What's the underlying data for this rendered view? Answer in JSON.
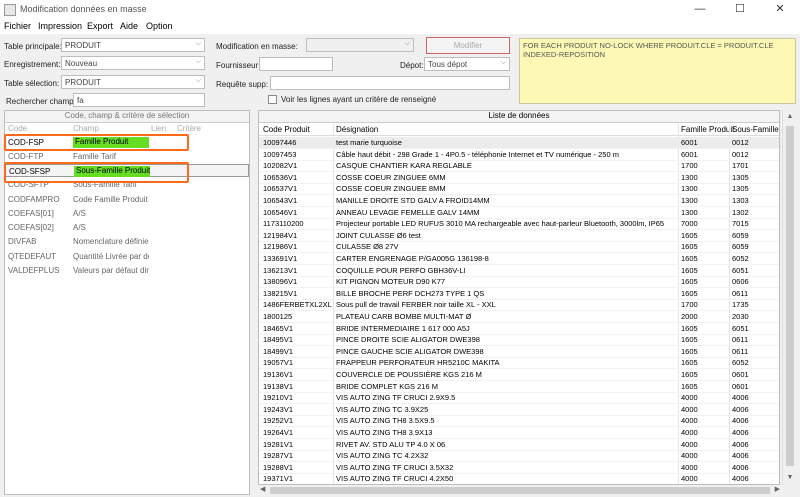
{
  "window": {
    "title": "Modification données en masse",
    "minimize": "—",
    "maximize": "☐",
    "close": "✕"
  },
  "menu": [
    "Fichier",
    "Impression",
    "Export",
    "Aide",
    "Option"
  ],
  "filters": {
    "table_principale_label": "Table principale:",
    "table_principale_value": "PRODUIT",
    "enregistrement_label": "Enregistrement:",
    "enregistrement_value": "Nouveau",
    "table_selection_label": "Table sélection:",
    "table_selection_value": "PRODUIT",
    "rechercher_label": "Rechercher champ:",
    "rechercher_value": "fa",
    "modif_masse_label": "Modification en masse:",
    "modif_masse_value": "",
    "modifier_button": "Modifier",
    "fournisseur_label": "Fournisseur:",
    "fournisseur_value": "",
    "depot_label": "Dépot:",
    "depot_value": "Tous dépot",
    "requete_label": "Requête supp:",
    "requete_value": "",
    "voir_lignes_label": "Voir les lignes ayant un critère de renseigné",
    "query_text": "FOR EACH PRODUIT NO-LOCK WHERE PRODUIT.CLE = PRODUIT.CLE INDEXED-REPOSITION"
  },
  "left_panel": {
    "header": "Code, champ & critère de sélection",
    "columns": [
      "Code",
      "Champ",
      "Lien",
      "Critère"
    ],
    "rows": [
      {
        "code": "COD-FSP",
        "champ": "Famille Produit",
        "green": true,
        "selected": true
      },
      {
        "code": "COD-FTP",
        "champ": "Famille Tarif"
      },
      {
        "code": "COD-SFSP",
        "champ": "Sous-Famille Produit",
        "green": true,
        "selected": true
      },
      {
        "code": "COD-SFTP",
        "champ": "Sous-Famille Tarif"
      },
      {
        "code": "CODFAMPRO",
        "champ": "Code Famille Produit"
      },
      {
        "code": "COEFAS[01]",
        "champ": "A/S"
      },
      {
        "code": "COEFAS[02]",
        "champ": "A/S"
      },
      {
        "code": "DIVFAB",
        "champ": "Nomenclature définie pour"
      },
      {
        "code": "QTEDEFAUT",
        "champ": "Quantité Livrée par défaut"
      },
      {
        "code": "VALDEFPLUS",
        "champ": "Valeurs par défaut dimensio"
      }
    ]
  },
  "right_panel": {
    "header": "Liste de données",
    "columns": [
      "Code Produit",
      "Désignation",
      "Famille Produit",
      "Sous-Famille Produit"
    ],
    "rows": [
      [
        "10097446",
        "test marie turquoise",
        "6001",
        "0012"
      ],
      [
        "10097453",
        "Câble haut débit - 298 Grade 1 - 4P0.5 - téléphonie Internet et TV numérique - 250 m",
        "6001",
        "0012"
      ],
      [
        "102082V1",
        "CASQUE CHANTIER KARA REGLABLE",
        "1700",
        "1701"
      ],
      [
        "106536V1",
        "COSSE COEUR ZINGUEE 6MM",
        "1300",
        "1305"
      ],
      [
        "106537V1",
        "COSSE COEUR ZINGUEE 8MM",
        "1300",
        "1305"
      ],
      [
        "106543V1",
        "MANILLE DROITE STD GALV A FROID14MM",
        "1300",
        "1303"
      ],
      [
        "106546V1",
        "ANNEAU LEVAGE FEMELLE GALV 14MM",
        "1300",
        "1302"
      ],
      [
        "1173110200",
        "Projecteur portable LED RUFUS 3010 MA rechargeable avec haut-parleur Bluetooth, 3000lm, IP65",
        "7000",
        "7015"
      ],
      [
        "121984V1",
        "JOINT CULASSE Ø6 test",
        "1605",
        "6059"
      ],
      [
        "121986V1",
        "CULASSE Ø8 27V",
        "1605",
        "6059"
      ],
      [
        "133691V1",
        "CARTER ENGRENAGE P/GA005G  136198-8",
        "1605",
        "6052"
      ],
      [
        "136213V1",
        "COQUILLE POUR PERFO GBH36V-LI",
        "1605",
        "6051"
      ],
      [
        "138096V1",
        "KIT PIGNON MOTEUR D90 K77",
        "1605",
        "0606"
      ],
      [
        "138215V1",
        "BILLE BROCHE PERF DCH273 TYPE 1 QS",
        "1605",
        "0611"
      ],
      [
        "1486FERBETXL2XL",
        "Sous pull de travail FERBER noir taille XL - XXL",
        "1700",
        "1735"
      ],
      [
        "1800125",
        "PLATEAU CARB BOMBE MULTI-MAT Ø",
        "2000",
        "2030"
      ],
      [
        "18465V1",
        "BRIDE INTERMEDIAIRE 1 617 000 A5J",
        "1605",
        "6051"
      ],
      [
        "18495V1",
        "PINCE DROITE SCIE ALIGATOR DWE398",
        "1605",
        "0611"
      ],
      [
        "18499V1",
        "PINCE GAUCHE SCIE ALIGATOR DWE398",
        "1605",
        "0611"
      ],
      [
        "19057V1",
        "FRAPPEUR PERFORATEUR HR5210C MAKITA",
        "1605",
        "6052"
      ],
      [
        "19136V1",
        "COUVERCLE DE POUSSIÈRE KGS 216 M",
        "1605",
        "0601"
      ],
      [
        "19138V1",
        "BRIDE COMPLET KGS 216 M",
        "1605",
        "0601"
      ],
      [
        "19210V1",
        "VIS AUTO ZING TF CRUCI 2.9X9.5",
        "4000",
        "4006"
      ],
      [
        "19243V1",
        "VIS AUTO ZING TC 3.9X25",
        "4000",
        "4006"
      ],
      [
        "19252V1",
        "VIS AUTO ZING TH8 3.5X9.5",
        "4000",
        "4006"
      ],
      [
        "19264V1",
        "VIS AUTO ZING TH8 3.9X13",
        "4000",
        "4006"
      ],
      [
        "19281V1",
        "RIVET AV. STD ALU TP 4.0 X 06",
        "4000",
        "4006"
      ],
      [
        "19287V1",
        "VIS AUTO ZING TC 4.2X32",
        "4000",
        "4006"
      ],
      [
        "19288V1",
        "VIS AUTO ZING TF CRUCI 3.5X32",
        "4000",
        "4006"
      ],
      [
        "19371V1",
        "VIS AUTO ZING TF CRUCI 4.2X50",
        "4000",
        "4006"
      ]
    ]
  }
}
